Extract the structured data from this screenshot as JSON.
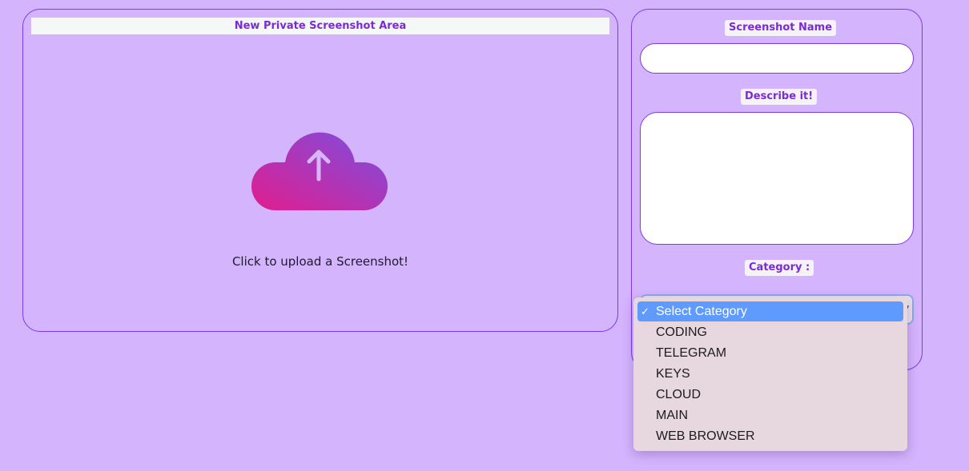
{
  "upload_area": {
    "title": "New Private Screenshot Area",
    "hint": "Click to upload a Screenshot!",
    "icon": "cloud-upload-icon"
  },
  "form": {
    "name_label": "Screenshot Name",
    "name_value": "",
    "description_label": "Describe it!",
    "description_value": "",
    "category_label": "Category :",
    "category_selected": "Select Category",
    "category_options": [
      {
        "label": "Select Category",
        "selected": true
      },
      {
        "label": "CODING",
        "selected": false
      },
      {
        "label": "TELEGRAM",
        "selected": false
      },
      {
        "label": "KEYS",
        "selected": false
      },
      {
        "label": "CLOUD",
        "selected": false
      },
      {
        "label": "MAIN",
        "selected": false
      },
      {
        "label": "WEB BROWSER",
        "selected": false
      }
    ],
    "checkmark": "✓"
  },
  "colors": {
    "background": "#d4b4fd",
    "accent": "#7c2ad6",
    "border": "#7c3aed",
    "highlight": "#5f9bff",
    "cloud_gradient_start": "#e11d8f",
    "cloud_gradient_end": "#7b4fe0"
  }
}
